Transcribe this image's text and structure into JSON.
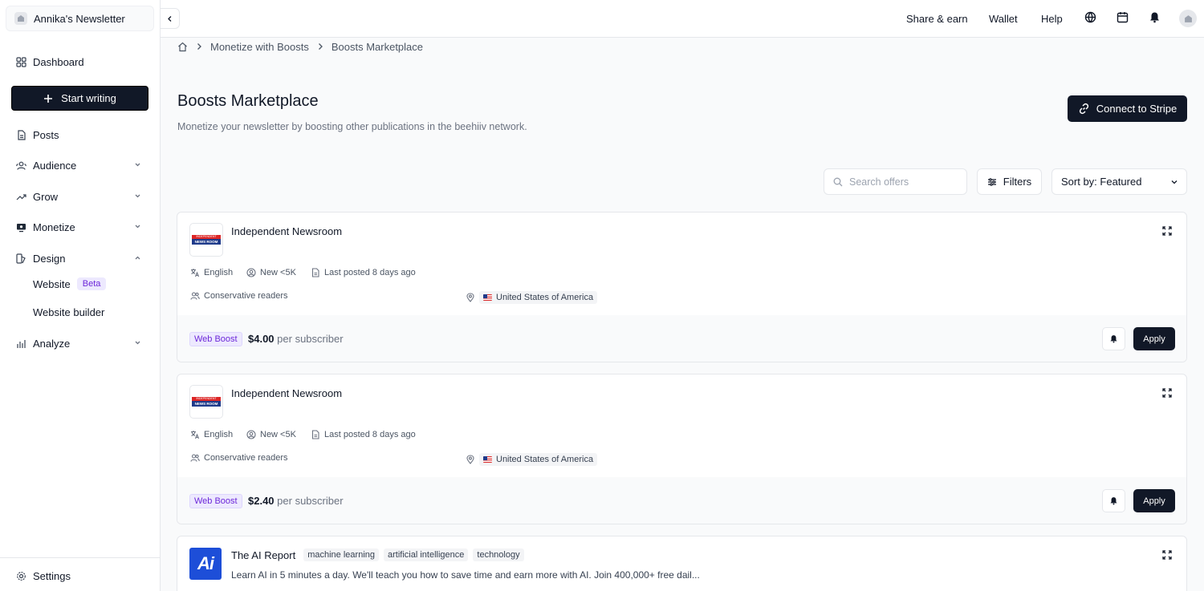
{
  "sidebar": {
    "publication": "Annika's Newsletter",
    "items": [
      {
        "label": "Dashboard"
      },
      {
        "label": "Posts"
      },
      {
        "label": "Audience"
      },
      {
        "label": "Grow"
      },
      {
        "label": "Monetize"
      },
      {
        "label": "Design"
      },
      {
        "label": "Analyze"
      }
    ],
    "design_sub": [
      {
        "label": "Website",
        "badge": "Beta"
      },
      {
        "label": "Website builder"
      }
    ],
    "start_writing": "Start writing",
    "settings": "Settings"
  },
  "topbar": {
    "share_earn": "Share & earn",
    "wallet": "Wallet",
    "help": "Help"
  },
  "breadcrumb": [
    "Monetize with Boosts",
    "Boosts Marketplace"
  ],
  "header": {
    "title": "Boosts Marketplace",
    "subtitle": "Monetize your newsletter by boosting other publications in the beehiiv network.",
    "connect_stripe": "Connect to Stripe"
  },
  "controls": {
    "search_placeholder": "Search offers",
    "filters": "Filters",
    "sort": "Sort by: Featured"
  },
  "offers": [
    {
      "name": "Independent Newsroom",
      "language": "English",
      "size": "New <5K",
      "last_posted": "Last posted 8 days ago",
      "audience": "Conservative readers",
      "country": "United States of America",
      "boost_type": "Web Boost",
      "price": "$4.00",
      "per": "per subscriber",
      "apply": "Apply"
    },
    {
      "name": "Independent Newsroom",
      "language": "English",
      "size": "New <5K",
      "last_posted": "Last posted 8 days ago",
      "audience": "Conservative readers",
      "country": "United States of America",
      "boost_type": "Web Boost",
      "price": "$2.40",
      "per": "per subscriber",
      "apply": "Apply"
    },
    {
      "name": "The AI Report",
      "tags": [
        "machine learning",
        "artificial intelligence",
        "technology"
      ],
      "description": "Learn AI in 5 minutes a day. We'll teach you how to save time and earn more with AI. Join 400,000+ free dail..."
    }
  ],
  "logos": {
    "newsroom_top": "INDEPENDENT",
    "newsroom_bottom": "NEWS ROOM",
    "ai_report": "Ai"
  },
  "colors": {
    "primary": "#111827",
    "boost_purple": "#6d28d9",
    "beta_bg": "#ede9fe"
  }
}
